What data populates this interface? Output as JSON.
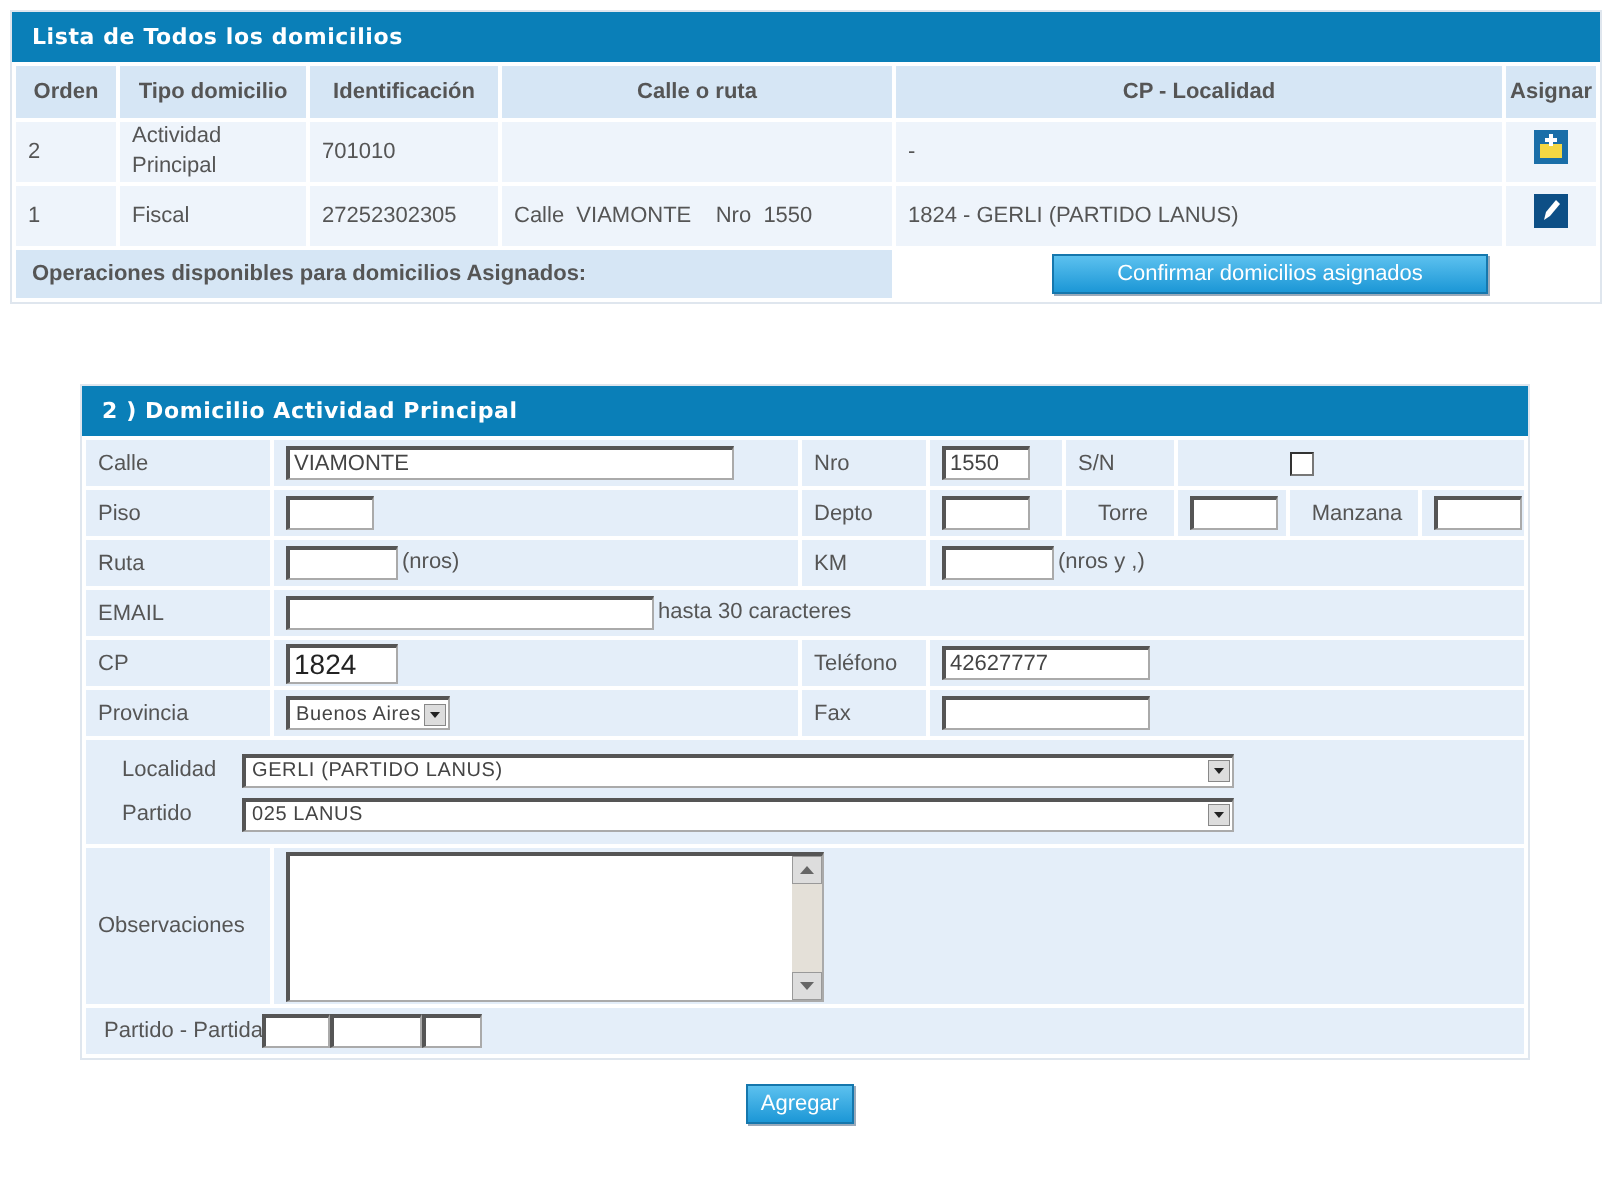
{
  "domicilios": {
    "title": "Lista de Todos los domicilios",
    "columns": [
      "Orden",
      "Tipo domicilio",
      "Identificación",
      "Calle o ruta",
      "CP - Localidad",
      "Asignar"
    ],
    "rows": [
      {
        "orden": "2",
        "tipo": "Actividad Principal",
        "identificacion": "701010",
        "calle": "",
        "cp_localidad": "-",
        "kind": "assign"
      },
      {
        "orden": "1",
        "tipo": "Fiscal",
        "identificacion": "27252302305",
        "calle": "Calle  VIAMONTE    Nro  1550",
        "cp_localidad": "1824 - GERLI (PARTIDO LANUS)",
        "kind": "edit"
      }
    ],
    "footer_label": "Operaciones disponibles para domicilios Asignados:",
    "footer_button": "Confirmar domicilios asignados"
  },
  "form": {
    "title": "2  )  Domicilio  Actividad Principal",
    "calle": {
      "label": "Calle",
      "value": "VIAMONTE"
    },
    "nro": {
      "label": "Nro",
      "value": "1550"
    },
    "sn": {
      "label": "S/N",
      "checked": false
    },
    "piso": {
      "label": "Piso"
    },
    "depto": {
      "label": "Depto"
    },
    "torre": {
      "label": "Torre"
    },
    "manzana": {
      "label": "Manzana"
    },
    "ruta": {
      "label": "Ruta",
      "hint": "(nros)"
    },
    "km": {
      "label": "KM",
      "hint": "(nros y ,)"
    },
    "email": {
      "label": "EMAIL",
      "hint": "hasta 30 caracteres"
    },
    "cp": {
      "label": "CP",
      "value": "1824"
    },
    "telefono": {
      "label": "Teléfono",
      "value": "42627777"
    },
    "provincia": {
      "label": "Provincia",
      "value": "Buenos Aires"
    },
    "fax": {
      "label": "Fax"
    },
    "localidad": {
      "label": "Localidad",
      "value": "GERLI (PARTIDO LANUS)"
    },
    "partido": {
      "label": "Partido",
      "value": "025 LANUS"
    },
    "observaciones": {
      "label": "Observaciones"
    },
    "partido_partida": {
      "label": "Partido - Partida"
    },
    "submit": "Agregar"
  }
}
